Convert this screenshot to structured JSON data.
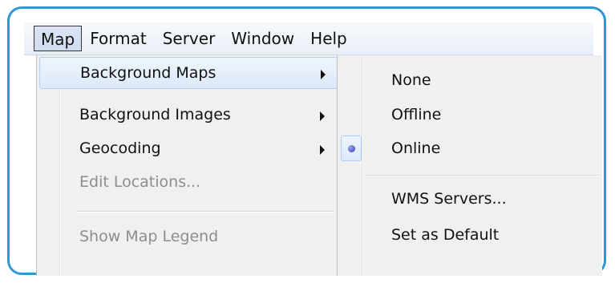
{
  "menubar": {
    "items": [
      {
        "label": "Map",
        "active": true
      },
      {
        "label": "Format"
      },
      {
        "label": "Server"
      },
      {
        "label": "Window"
      },
      {
        "label": "Help"
      }
    ]
  },
  "map_menu": {
    "items": [
      {
        "label": "Background Maps",
        "submenu": true,
        "highlighted": true
      },
      {
        "label": "Background Images",
        "submenu": true
      },
      {
        "label": "Geocoding",
        "submenu": true
      },
      {
        "label": "Edit Locations...",
        "disabled": true
      },
      {
        "label": "Show Map Legend",
        "disabled": true
      }
    ]
  },
  "background_maps_submenu": {
    "items": [
      {
        "label": "None"
      },
      {
        "label": "Offline"
      },
      {
        "label": "Online",
        "checked": true
      },
      {
        "label": "WMS Servers..."
      },
      {
        "label": "Set as Default"
      }
    ]
  },
  "colors": {
    "frame_border": "#2f97d6",
    "menu_background": "#f0f0f0",
    "highlight_border": "#aecdf2",
    "disabled_text": "#8d8d8d"
  }
}
